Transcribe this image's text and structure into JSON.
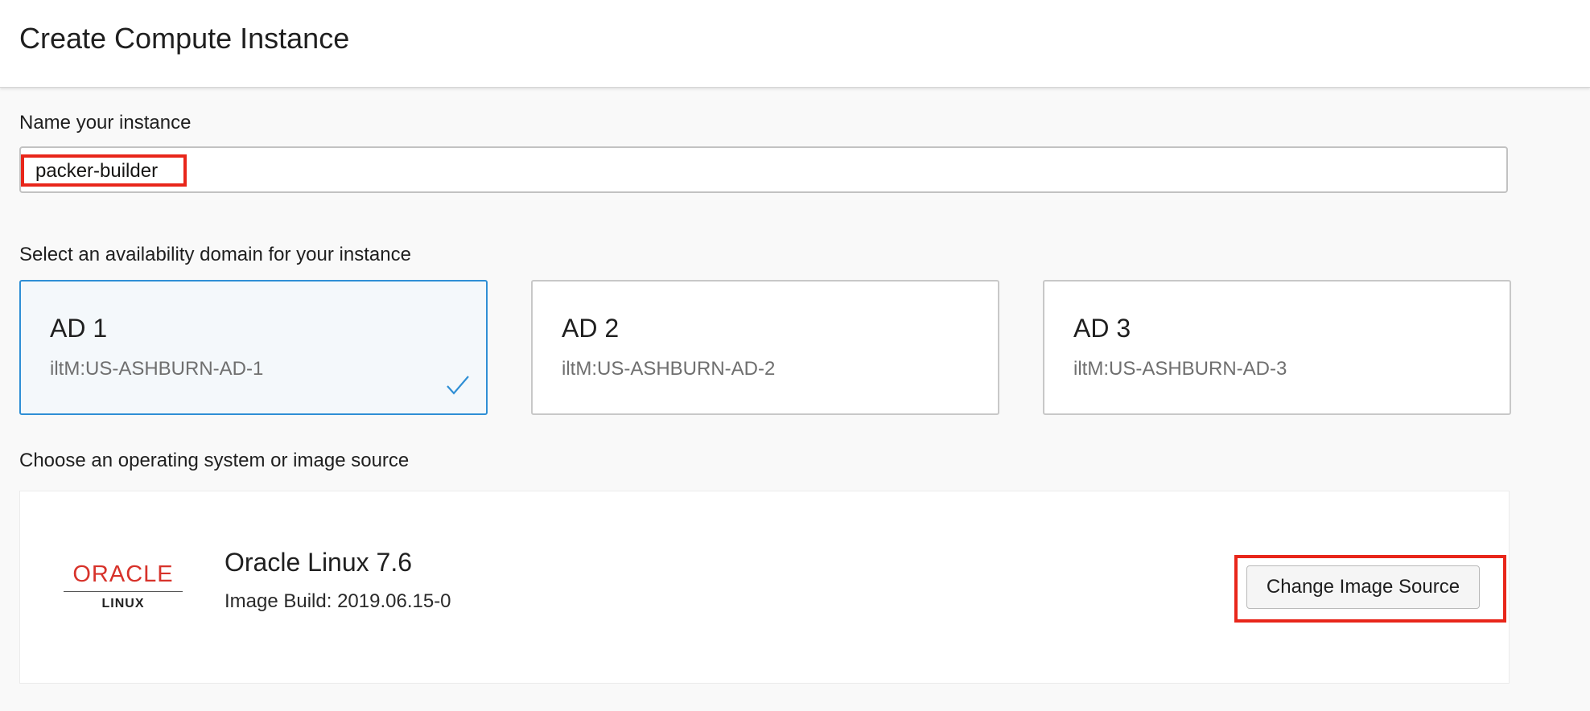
{
  "header": {
    "title": "Create Compute Instance"
  },
  "name_section": {
    "label": "Name your instance",
    "value": "packer-builder"
  },
  "ad_section": {
    "label": "Select an availability domain for your instance",
    "options": [
      {
        "title": "AD 1",
        "subtitle": "iltM:US-ASHBURN-AD-1",
        "selected": true
      },
      {
        "title": "AD 2",
        "subtitle": "iltM:US-ASHBURN-AD-2",
        "selected": false
      },
      {
        "title": "AD 3",
        "subtitle": "iltM:US-ASHBURN-AD-3",
        "selected": false
      }
    ]
  },
  "image_section": {
    "label": "Choose an operating system or image source",
    "logo": {
      "word": "ORACLE",
      "sub": "LINUX",
      "icon": "oracle-linux-logo"
    },
    "os_name": "Oracle Linux 7.6",
    "build": "Image Build: 2019.06.15-0",
    "change_button": "Change Image Source"
  },
  "colors": {
    "accent": "#2f8fd5",
    "highlight": "#e8261a",
    "oracle_red": "#d7322a"
  }
}
